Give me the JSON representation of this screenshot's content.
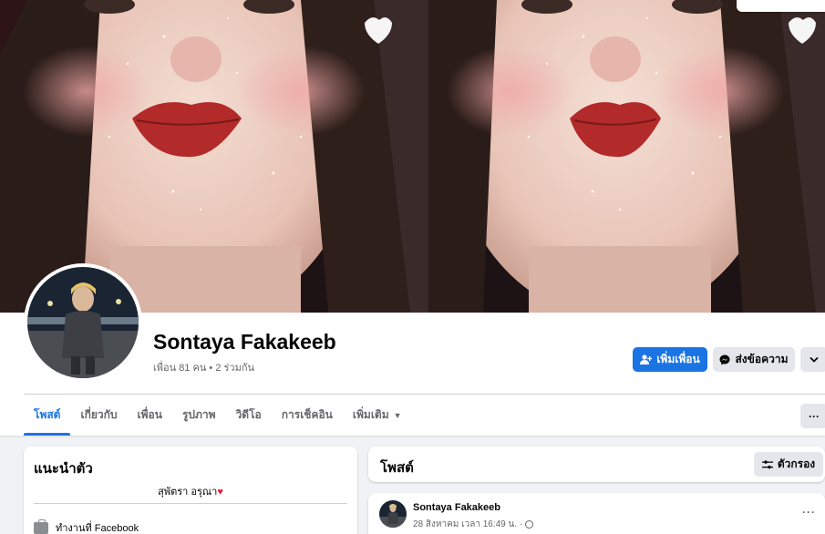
{
  "profile": {
    "name": "Sontaya Fakakeeb",
    "friends": "เพื่อน 81 คน • 2 ร่วมกัน"
  },
  "actions": {
    "add_friend": "เพิ่มเพื่อน",
    "message": "ส่งข้อความ",
    "more": "⌄"
  },
  "tabs": [
    {
      "label": "โพสต์"
    },
    {
      "label": "เกี่ยวกับ"
    },
    {
      "label": "เพื่อน"
    },
    {
      "label": "รูปภาพ"
    },
    {
      "label": "วิดีโอ"
    },
    {
      "label": "การเช็คอิน"
    },
    {
      "label": "เพิ่มเติม"
    }
  ],
  "tab_more_dots": "···",
  "intro": {
    "title": "แนะนำตัว",
    "bio": "สุพัตรา อรุณา",
    "work": "ทำงานที่ Facebook"
  },
  "posts": {
    "title": "โพสต์",
    "filter": "ตัวกรอง"
  },
  "post": {
    "author": "Sontaya Fakakeeb",
    "time": "28 สิงหาคม เวลา 16:49 น. ·",
    "dots": "···"
  },
  "colors": {
    "accent": "#1b74e4",
    "background": "#f0f2f5",
    "heart": "#e41e3f"
  }
}
